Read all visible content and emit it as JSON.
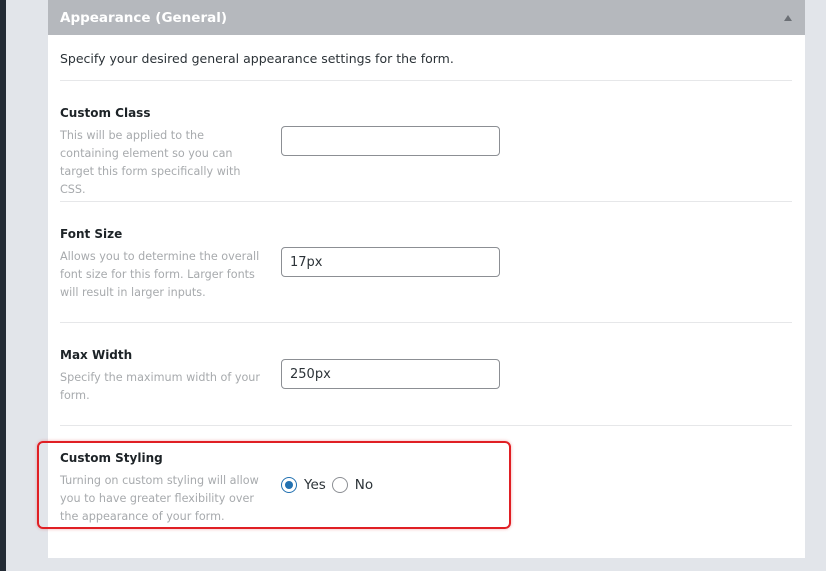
{
  "panel": {
    "title": "Appearance (General)",
    "description": "Specify your desired general appearance settings for the form."
  },
  "fields": {
    "custom_class": {
      "label": "Custom Class",
      "help": "This will be applied to the containing element so you can target this form specifically with CSS.",
      "value": ""
    },
    "font_size": {
      "label": "Font Size",
      "help": "Allows you to determine the overall font size for this form. Larger fonts will result in larger inputs.",
      "value": "17px"
    },
    "max_width": {
      "label": "Max Width",
      "help": "Specify the maximum width of your form.",
      "value": "250px"
    },
    "custom_styling": {
      "label": "Custom Styling",
      "help": "Turning on custom styling will allow you to have greater flexibility over the appearance of your form.",
      "options": [
        "Yes",
        "No"
      ],
      "selected": "Yes"
    }
  },
  "colors": {
    "header_bg": "#b5b8bd",
    "accent": "#2271b1",
    "highlight": "#e01f24"
  }
}
